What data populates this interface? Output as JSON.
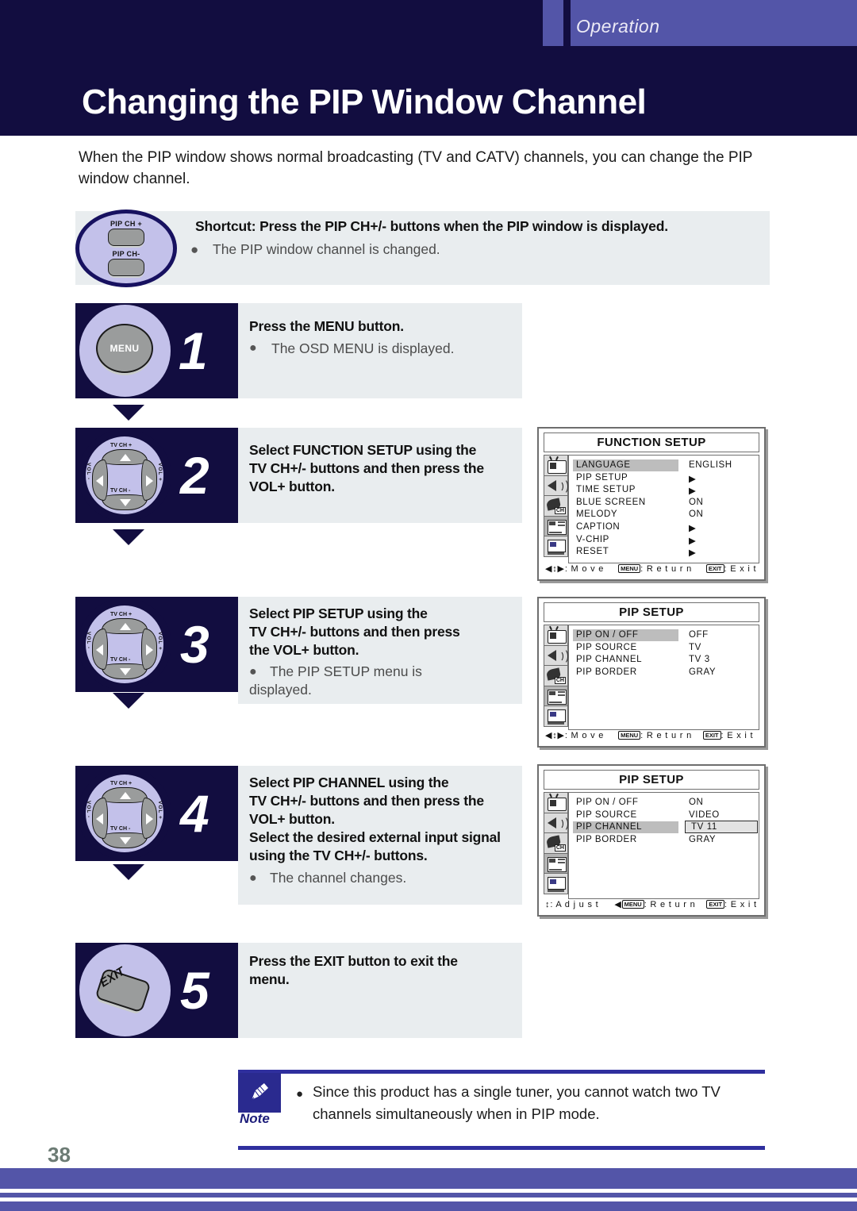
{
  "header": {
    "section_label": "Operation",
    "title": "Changing the PIP Window Channel",
    "band_color": "#120d40",
    "accent_color": "#5355a8"
  },
  "intro": "When the PIP window shows normal broadcasting (TV and CATV) channels, you can change the PIP window channel.",
  "shortcut": {
    "title": "Shortcut: Press the PIP CH+/- buttons when the PIP window is displayed.",
    "bullet": "●",
    "sub": "The PIP window channel is changed.",
    "button_top_label": "PIP CH +",
    "button_bottom_label": "PIP CH-"
  },
  "dpad": {
    "up_label": "TV CH +",
    "down_label": "TV CH -",
    "left_label": "VOL -",
    "right_label": "VOL +"
  },
  "steps": [
    {
      "number": "1",
      "icon": "menu-button",
      "icon_label": "MENU",
      "head": "Press the MENU button.",
      "bullet": "●",
      "sub": "The OSD MENU is displayed."
    },
    {
      "number": "2",
      "icon": "dpad",
      "head": "Select FUNCTION SETUP using the TV CH+/- buttons and then press the VOL+ button.",
      "bullet": "",
      "sub": ""
    },
    {
      "number": "3",
      "icon": "dpad",
      "head": "Select PIP SETUP using the TV CH+/- buttons and then press the VOL+ button.",
      "bullet": "●",
      "sub": "The PIP SETUP menu is displayed."
    },
    {
      "number": "4",
      "icon": "dpad",
      "head": "Select PIP CHANNEL using the TV CH+/- buttons and then press the VOL+ button. Select the desired external input signal using the TV CH+/- buttons.",
      "bullet": "●",
      "sub": "The channel changes."
    },
    {
      "number": "5",
      "icon": "exit-button",
      "icon_label": "EXIT",
      "head": "Press the EXIT button to exit the menu.",
      "bullet": "",
      "sub": ""
    }
  ],
  "step_head_lines": {
    "s2": [
      "Select FUNCTION SETUP using the",
      "TV CH+/- buttons and then press the",
      "VOL+ button."
    ],
    "s3": [
      "Select PIP SETUP using the",
      "TV CH+/- buttons and then press",
      "the VOL+ button."
    ],
    "s4": [
      "Select PIP CHANNEL using the",
      "TV CH+/- buttons and then press the",
      "VOL+ button.",
      "Select the desired external input signal",
      "using the TV CH+/- buttons."
    ],
    "s5": [
      "Press the EXIT button to exit the",
      "menu."
    ],
    "s3_sub": [
      "The PIP SETUP menu is",
      "displayed."
    ]
  },
  "osd_menus": [
    {
      "id": "function-setup",
      "title": "FUNCTION SETUP",
      "sidebar_icons": [
        "tv-icon",
        "speaker-icon",
        "antenna-ch-icon",
        "pip-layout-icon",
        "monitor-icon"
      ],
      "active_icon_index": 4,
      "highlight_row": 0,
      "rows": [
        {
          "label": "LANGUAGE",
          "value": "ENGLISH"
        },
        {
          "label": "PIP SETUP",
          "value": "▶"
        },
        {
          "label": "TIME SETUP",
          "value": "▶"
        },
        {
          "label": "BLUE SCREEN",
          "value": "ON"
        },
        {
          "label": "MELODY",
          "value": "ON"
        },
        {
          "label": "CAPTION",
          "value": "▶"
        },
        {
          "label": "V-CHIP",
          "value": "▶"
        },
        {
          "label": "RESET",
          "value": "▶"
        }
      ],
      "footer": {
        "nav_glyph": "◀↕▶",
        "move": ": M o v e",
        "menu_key": "MENU",
        "return": ": R e t u r n",
        "exit_key": "EXIT",
        "exit": ": E x i t"
      }
    },
    {
      "id": "pip-setup-before",
      "title": "PIP SETUP",
      "sidebar_icons": [
        "tv-icon",
        "speaker-icon",
        "antenna-ch-icon",
        "pip-layout-icon",
        "monitor-icon"
      ],
      "active_icon_index": 3,
      "highlight_row": 0,
      "rows": [
        {
          "label": "PIP ON / OFF",
          "value": "OFF"
        },
        {
          "label": "PIP SOURCE",
          "value": "TV"
        },
        {
          "label": "PIP CHANNEL",
          "value": "TV 3"
        },
        {
          "label": "PIP BORDER",
          "value": "GRAY"
        }
      ],
      "footer": {
        "nav_glyph": "◀↕▶",
        "move": ": M o v e",
        "menu_key": "MENU",
        "return": ": R e t u r n",
        "exit_key": "EXIT",
        "exit": ": E x i t"
      }
    },
    {
      "id": "pip-setup-after",
      "title": "PIP SETUP",
      "sidebar_icons": [
        "tv-icon",
        "speaker-icon",
        "antenna-ch-icon",
        "pip-layout-icon",
        "monitor-icon"
      ],
      "active_icon_index": 3,
      "highlight_row": 2,
      "value_box_row": 2,
      "rows": [
        {
          "label": "PIP ON / OFF",
          "value": "ON"
        },
        {
          "label": "PIP SOURCE",
          "value": "VIDEO"
        },
        {
          "label": "PIP CHANNEL",
          "value": "TV 11"
        },
        {
          "label": "PIP BORDER",
          "value": "GRAY"
        }
      ],
      "footer": {
        "nav_glyph": "↕",
        "move": ": A d j u s t",
        "menu_key": "MENU",
        "return": ": R e t u r n",
        "exit_key": "EXIT",
        "exit": ": E x i t",
        "return_prefix": "◀"
      }
    }
  ],
  "note": {
    "label": "Note",
    "bullet": "●",
    "text": "Since this product has a single tuner, you cannot watch two TV channels simultaneously when in PIP mode."
  },
  "footer": {
    "page_number": "38",
    "band_color": "#5355a8"
  }
}
